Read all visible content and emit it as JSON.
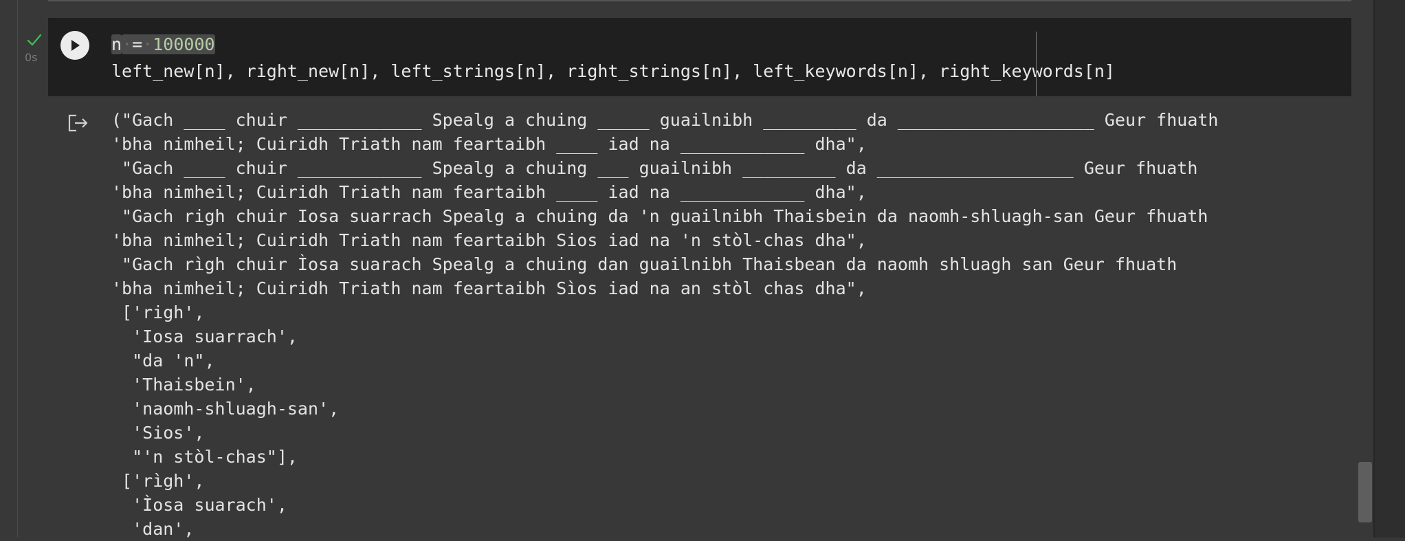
{
  "cell": {
    "exec_time": "0s",
    "code_line1": {
      "var": "n",
      "op": "=",
      "value": "100000"
    },
    "code_line2": "left_new[n], right_new[n], left_strings[n], right_strings[n], left_keywords[n], right_keywords[n]"
  },
  "output": {
    "lines": [
      "(\"Gach ____ chuir ____________ Spealg a chuing _____ guailnibh _________ da ___________________ Geur fhuath",
      "'bha nimheil; Cuiridh Triath nam feartaibh ____ iad na ____________ dha\",",
      " \"Gach ____ chuir ____________ Spealg a chuing ___ guailnibh _________ da ___________________ Geur fhuath",
      "'bha nimheil; Cuiridh Triath nam feartaibh ____ iad na ____________ dha\",",
      " \"Gach righ chuir Iosa suarrach Spealg a chuing da 'n guailnibh Thaisbein da naomh-shluagh-san Geur fhuath",
      "'bha nimheil; Cuiridh Triath nam feartaibh Sios iad na 'n stòl-chas dha\",",
      " \"Gach rìgh chuir Ìosa suarach Spealg a chuing dan guailnibh Thaisbean da naomh shluagh san Geur fhuath",
      "'bha nimheil; Cuiridh Triath nam feartaibh Sìos iad na an stòl chas dha\",",
      " ['righ',",
      "  'Iosa suarrach',",
      "  \"da 'n\",",
      "  'Thaisbein',",
      "  'naomh-shluagh-san',",
      "  'Sios',",
      "  \"'n stòl-chas\"],",
      " ['rìgh',",
      "  'Ìosa suarach',",
      "  'dan',"
    ]
  },
  "icons": {
    "check": "check-icon",
    "run": "play-icon",
    "output": "output-redirect-icon"
  },
  "colors": {
    "background": "#383838",
    "code_bg": "#1f1f1f",
    "check": "#3fb950",
    "number": "#b5cea8"
  }
}
